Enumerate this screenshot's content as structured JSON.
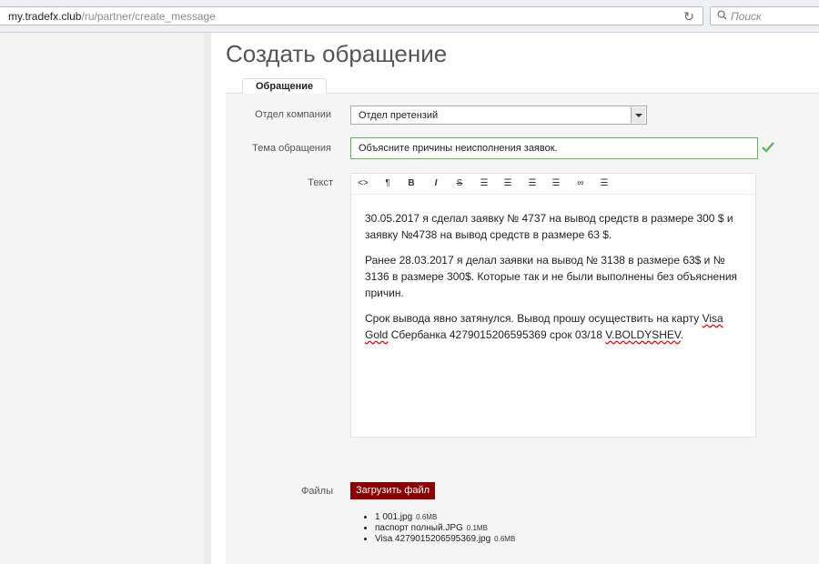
{
  "browser": {
    "url_host": "my.tradefx.club",
    "url_path": "/ru/partner/create_message",
    "search_placeholder": "Поиск"
  },
  "page": {
    "title": "Создать обращение",
    "tab_label": "Обращение"
  },
  "form": {
    "department_label": "Отдел компании",
    "department_value": "Отдел претензий",
    "subject_label": "Тема обращения",
    "subject_value": "Объясните причины неисполнения заявок.",
    "text_label": "Текст",
    "files_label": "Файлы",
    "upload_button": "Загрузить файл"
  },
  "editor": {
    "toolbar": [
      {
        "name": "code-icon",
        "glyph": "<>"
      },
      {
        "name": "paragraph-icon",
        "glyph": "¶"
      },
      {
        "name": "bold-icon",
        "glyph": "B"
      },
      {
        "name": "italic-icon",
        "glyph": "I"
      },
      {
        "name": "strikethrough-icon",
        "glyph": "S"
      },
      {
        "name": "bullet-list-icon",
        "glyph": "☰"
      },
      {
        "name": "numbered-list-icon",
        "glyph": "☰"
      },
      {
        "name": "outdent-icon",
        "glyph": "☰"
      },
      {
        "name": "indent-icon",
        "glyph": "☰"
      },
      {
        "name": "link-icon",
        "glyph": "∞"
      },
      {
        "name": "align-icon",
        "glyph": "☰"
      }
    ],
    "p1": "30.05.2017 я сделал заявку № 4737 на вывод средств в размере 300 $ и заявку №4738 на вывод средств в размере 63 $.",
    "p2": "Ранее 28.03.2017 я делал заявки на вывод № 3138 в размере 63$ и № 3136 в размере 300$. Которые так и не были выполнены без объяснения причин.",
    "p3_a": "Срок вывода явно затянулся. Вывод прошу осуществить на карту ",
    "p3_visa": "Visa Gold",
    "p3_b": " Сбербанка 4279015206595369 срок 03/18 ",
    "p3_name": "V.BOLDYSHEV",
    "p3_end": "."
  },
  "files": [
    {
      "name": "1 001.jpg",
      "size": "0.6MB"
    },
    {
      "name": "паспорт полный.JPG",
      "size": "0.1MB"
    },
    {
      "name": "Visa 4279015206595369.jpg",
      "size": "0.6MB"
    }
  ],
  "colors": {
    "accent_valid": "#5cb85c",
    "upload_button": "#8b0000"
  }
}
